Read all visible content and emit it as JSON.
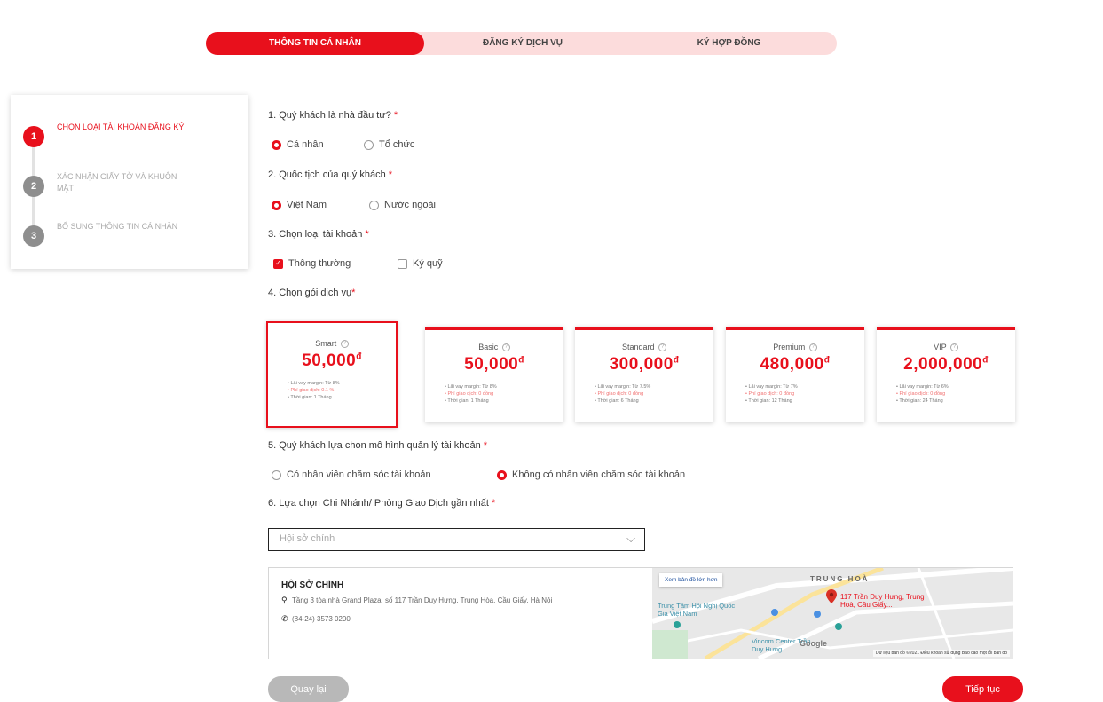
{
  "tabs": [
    "THÔNG TIN CÁ NHÂN",
    "ĐĂNG KÝ DỊCH VỤ",
    "KÝ HỢP ĐỒNG"
  ],
  "steps": [
    {
      "num": "1",
      "label": "CHỌN LOẠI TÀI KHOẢN ĐĂNG KÝ"
    },
    {
      "num": "2",
      "label": "XÁC NHẬN GIẤY TỜ VÀ KHUÔN MẶT"
    },
    {
      "num": "3",
      "label": "BỔ SUNG THÔNG TIN CÁ NHÂN"
    }
  ],
  "questions": {
    "q1": "1. Quý khách là nhà đầu tư?",
    "q1_opts": [
      "Cá nhân",
      "Tổ chức"
    ],
    "q2": "2. Quốc tịch của quý khách",
    "q2_opts": [
      "Việt Nam",
      "Nước ngoài"
    ],
    "q3": "3. Chọn loại tài khoản",
    "q3_opts": [
      "Thông thường",
      "Ký quỹ"
    ],
    "q4": "4. Chọn gói dịch vụ",
    "q5": "5. Quý khách lựa chọn mô hình quản lý tài khoản",
    "q5_opts": [
      "Có nhân viên chăm sóc tài khoản",
      "Không có nhân viên chăm sóc tài khoản"
    ],
    "q6": "6. Lựa chọn Chi Nhánh/ Phòng Giao Dịch gần nhất"
  },
  "required_mark": "*",
  "packages": [
    {
      "name": "Smart",
      "price": "50,000",
      "currency": "đ",
      "f1": "• Lãi vay margin: Từ 8%",
      "f2": "• Phí giao dịch: 0.1 %",
      "f3": "• Thời gian: 1 Tháng"
    },
    {
      "name": "Basic",
      "price": "50,000",
      "currency": "đ",
      "f1": "• Lãi vay margin: Từ 8%",
      "f2": "• Phí giao dịch: 0 đồng",
      "f3": "• Thời gian: 1 Tháng"
    },
    {
      "name": "Standard",
      "price": "300,000",
      "currency": "đ",
      "f1": "• Lãi vay margin: Từ 7.5%",
      "f2": "• Phí giao dịch: 0 đồng",
      "f3": "• Thời gian: 6 Tháng"
    },
    {
      "name": "Premium",
      "price": "480,000",
      "currency": "đ",
      "f1": "• Lãi vay margin: Từ 7%",
      "f2": "• Phí giao dịch: 0 đồng",
      "f3": "• Thời gian: 12 Tháng"
    },
    {
      "name": "VIP",
      "price": "2,000,000",
      "currency": "đ",
      "f1": "• Lãi vay margin: Từ 6%",
      "f2": "• Phí giao dịch: 0 đồng",
      "f3": "• Thời gian: 24 Tháng"
    }
  ],
  "branch_select": {
    "placeholder": "Hội sở chính"
  },
  "branch": {
    "title": "HỘI SỞ CHÍNH",
    "address": "Tầng 3 tòa nhà Grand Plaza, số 117 Trần Duy Hưng, Trung Hòa, Cầu Giấy, Hà Nội",
    "phone": "(84-24) 3573 0200"
  },
  "map": {
    "larger_map": "Xem bản đồ lớn hơn",
    "area": "TRUNG HOÀ",
    "pin_label": "117 Trần Duy Hưng, Trung Hoà, Cầu Giấy...",
    "poi1": "Trung Tâm Hội Nghị Quốc Gia Việt Nam",
    "poi2": "Vincom Center Trần Duy Hưng",
    "google": "Google",
    "footer": "Dữ liệu bản đồ ©2021   Điều khoản sử dụng   Báo cáo một lỗi bản đồ"
  },
  "buttons": {
    "back": "Quay lại",
    "next": "Tiếp tục"
  },
  "colors": {
    "accent": "#e8101c"
  }
}
